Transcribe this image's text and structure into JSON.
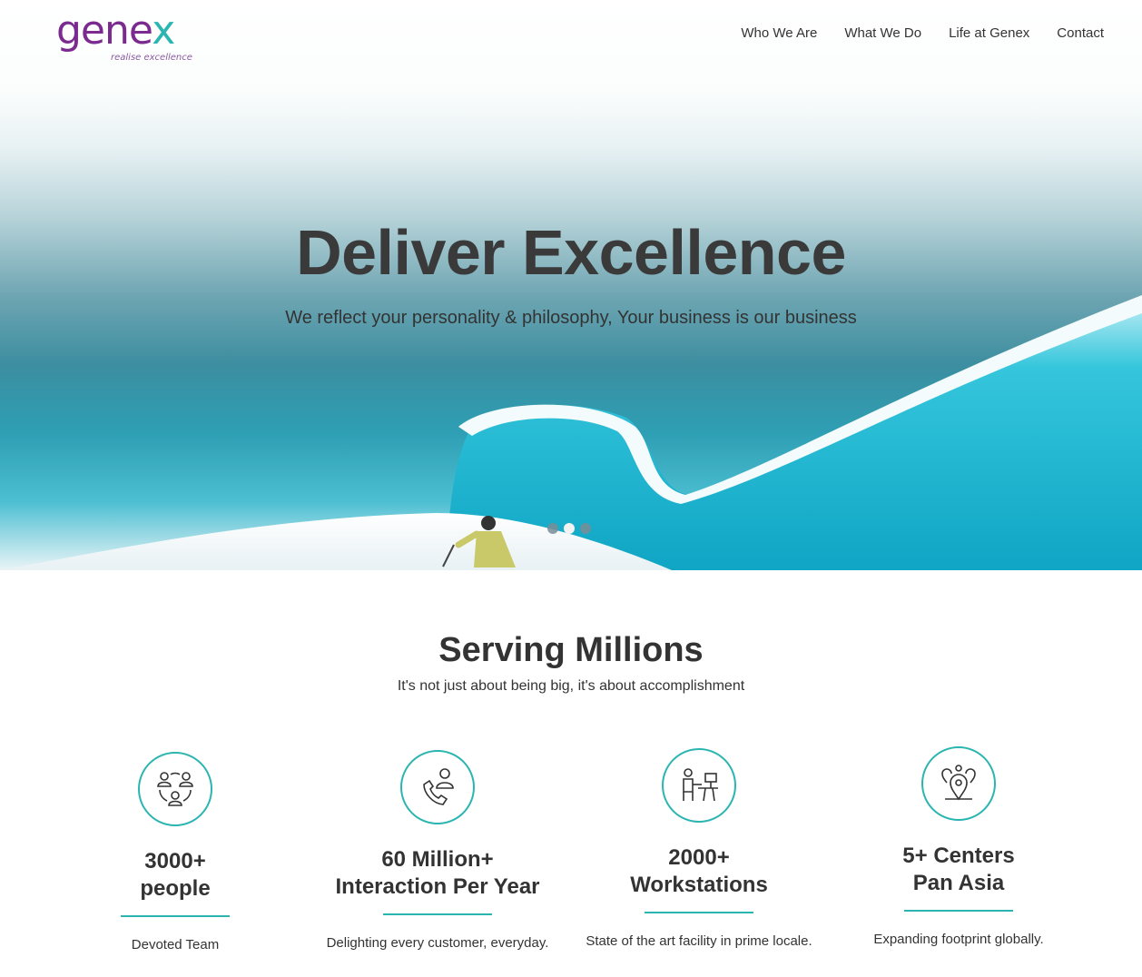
{
  "header": {
    "logo_text": "genex",
    "logo_tagline": "realise excellence",
    "nav": [
      "Who We Are",
      "What We Do",
      "Life at Genex",
      "Contact"
    ]
  },
  "hero": {
    "title": "Deliver Excellence",
    "subtitle": "We reflect your personality & philosophy, Your business is our business",
    "slides_total": 3,
    "active_slide": 2
  },
  "serving": {
    "title": "Serving Millions",
    "subtitle": "It's not just about being big, it's about accomplishment"
  },
  "stats": [
    {
      "icon": "team-icon",
      "line1": "3000+",
      "line2": "people",
      "desc": "Devoted Team"
    },
    {
      "icon": "phone-support-icon",
      "line1": "60 Million+",
      "line2": "Interaction Per Year",
      "desc": "Delighting every customer, everyday."
    },
    {
      "icon": "workstation-icon",
      "line1": "2000+",
      "line2": "Workstations",
      "desc": "State of the art facility in prime locale."
    },
    {
      "icon": "location-pins-icon",
      "line1": "5+ Centers",
      "line2": "Pan Asia",
      "desc": "Expanding footprint globally."
    }
  ],
  "colors": {
    "brand_purple": "#7b2a8f",
    "brand_teal": "#2bb5b1",
    "text": "#333333"
  }
}
